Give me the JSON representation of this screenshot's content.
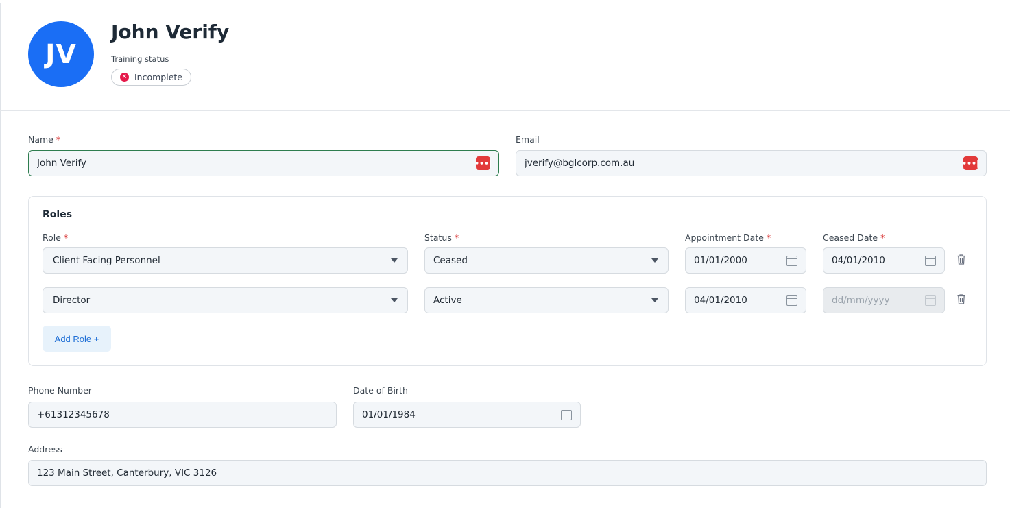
{
  "header": {
    "avatar_initials": "JV",
    "name": "John Verify",
    "training_label": "Training status",
    "training_status": "Incomplete"
  },
  "form": {
    "name": {
      "label": "Name",
      "required": "*",
      "value": "John Verify"
    },
    "email": {
      "label": "Email",
      "value": "jverify@bglcorp.com.au"
    },
    "password_manager_icon_glyph": "•••|",
    "roles": {
      "title": "Roles",
      "columns": {
        "role": "Role",
        "status": "Status",
        "appointment": "Appointment Date",
        "ceased": "Ceased Date"
      },
      "required": "*",
      "rows": [
        {
          "role": "Client Facing Personnel",
          "status": "Ceased",
          "appointment": "01/01/2000",
          "ceased": "04/01/2010",
          "ceased_placeholder": ""
        },
        {
          "role": "Director",
          "status": "Active",
          "appointment": "04/01/2010",
          "ceased": "",
          "ceased_placeholder": "dd/mm/yyyy"
        }
      ],
      "add_label": "Add Role +"
    },
    "phone": {
      "label": "Phone Number",
      "value": "+61312345678"
    },
    "dob": {
      "label": "Date of Birth",
      "value": "01/01/1984"
    },
    "address": {
      "label": "Address",
      "value": "123 Main Street, Canterbury, VIC 3126"
    }
  },
  "colors": {
    "avatar": "#1a6ef5",
    "status_incomplete": "#e5194a",
    "focus_border": "#2e7d4f",
    "password_icon": "#e23a3a",
    "add_role_text": "#1f6fd6"
  }
}
